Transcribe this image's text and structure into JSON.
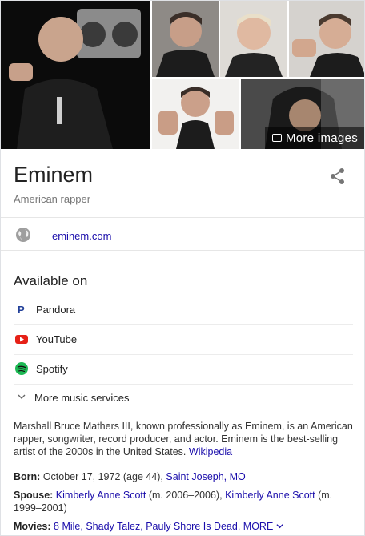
{
  "images": {
    "more_images_label": "More images"
  },
  "header": {
    "title": "Eminem",
    "subtitle": "American rapper"
  },
  "website": {
    "label": "eminem.com"
  },
  "available_on": {
    "title": "Available on",
    "services": [
      {
        "label": "Pandora",
        "icon": "pandora-icon",
        "color": "#224099"
      },
      {
        "label": "YouTube",
        "icon": "youtube-icon",
        "color": "#e62117"
      },
      {
        "label": "Spotify",
        "icon": "spotify-icon",
        "color": "#1db954"
      }
    ],
    "more_label": "More music services"
  },
  "description": {
    "text": "Marshall Bruce Mathers III, known professionally as Eminem, is an American rapper, songwriter, record producer, and actor. Eminem is the best-selling artist of the 2000s in the United States.",
    "source": "Wikipedia"
  },
  "facts": {
    "born": {
      "label": "Born:",
      "value": "October 17, 1972 (age 44),",
      "place": "Saint Joseph, MO"
    },
    "spouse": {
      "label": "Spouse:",
      "name1": "Kimberly Anne Scott",
      "dates1": "(m. 2006–2006),",
      "name2": "Kimberly Anne Scott",
      "dates2": "(m. 1999–2001)"
    },
    "movies": {
      "label": "Movies:",
      "items": [
        "8 Mile,",
        "Shady Talez,",
        "Pauly Shore Is Dead,"
      ],
      "more_label": "MORE"
    }
  },
  "colors": {
    "link": "#1a0dab",
    "text": "#222222",
    "muted": "#777777"
  }
}
